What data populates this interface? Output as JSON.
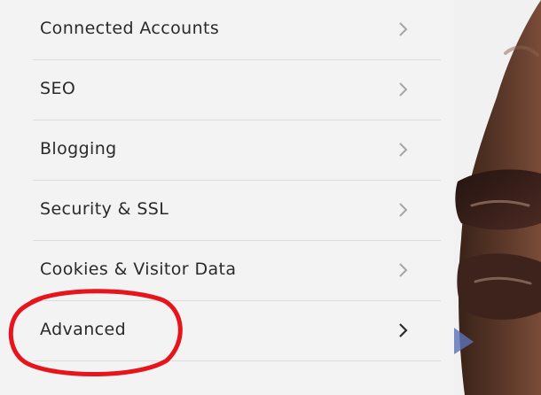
{
  "settings": {
    "items": [
      {
        "label": "Connected Accounts",
        "chevron_icon": "chevron-right-icon",
        "chevron_color": "#a5a5a5"
      },
      {
        "label": "SEO",
        "chevron_icon": "chevron-right-icon",
        "chevron_color": "#a5a5a5"
      },
      {
        "label": "Blogging",
        "chevron_icon": "chevron-right-icon",
        "chevron_color": "#a5a5a5"
      },
      {
        "label": "Security & SSL",
        "chevron_icon": "chevron-right-icon",
        "chevron_color": "#a5a5a5"
      },
      {
        "label": "Cookies & Visitor Data",
        "chevron_icon": "chevron-right-icon",
        "chevron_color": "#a5a5a5"
      },
      {
        "label": "Advanced",
        "chevron_icon": "chevron-right-icon",
        "chevron_color": "#2c2c2c"
      }
    ]
  },
  "annotation": {
    "shape": "circle",
    "color": "#e8141b",
    "target": "Advanced"
  },
  "colors": {
    "panel_background": "#f3f3f3",
    "divider": "#dcdcdc",
    "text": "#2a2a2a"
  }
}
